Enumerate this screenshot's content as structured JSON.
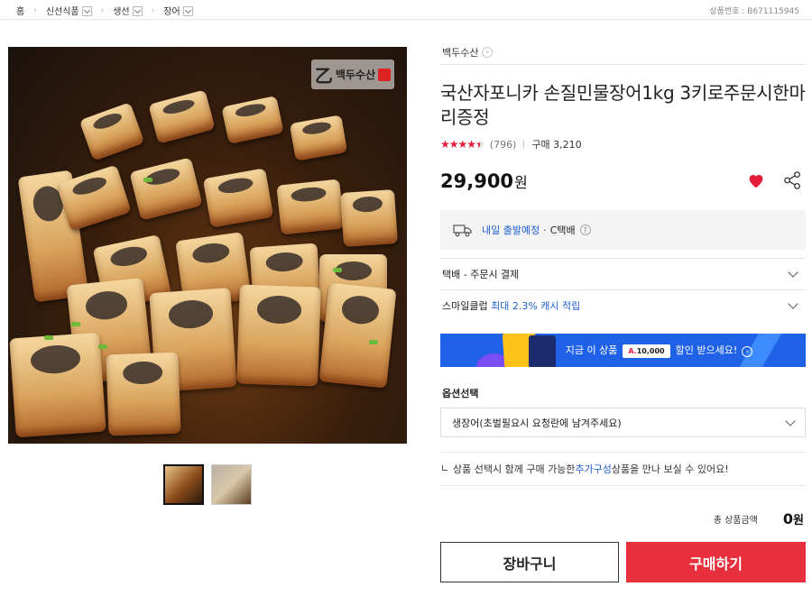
{
  "breadcrumb": {
    "items": [
      "홈",
      "신선식품",
      "생선",
      "장어"
    ]
  },
  "product_no_label": "상품번호 : B671115945",
  "image_logo_text": "백두수산",
  "thumbnails": [
    "thumbnail-1",
    "thumbnail-2"
  ],
  "store": {
    "name": "백두수산"
  },
  "product": {
    "title": "국산자포니카 손질민물장어1kg 3키로주문시한마리증정",
    "rating_value": 0.9,
    "review_count": "(796)",
    "purchase_count": "구매 3,210",
    "price": "29,900",
    "currency": "원"
  },
  "shipping": {
    "date_text": "내일 출발예정",
    "separator": "·",
    "carrier": "C택배",
    "help": "?"
  },
  "rows": {
    "delivery": "택배 - 주문시 결제",
    "smile_prefix": "스마일클럽 ",
    "smile_benefit": "최대 2.3% 캐시 적립"
  },
  "banner": {
    "prefix": "지금 이 상품",
    "coupon_prefix": "A.",
    "coupon_amount": "10,000",
    "suffix": "할인 받으세요!",
    "arrow": "›"
  },
  "options": {
    "label": "옵션선택",
    "selected": "생장어(초벌필요시 요청란에 남겨주세요)"
  },
  "hint": {
    "before": "상품 선택시 함께 구매 가능한 ",
    "link": "추가구성",
    "after": " 상품을 만나 보실 수 있어요!"
  },
  "total": {
    "label": "총 상품금액",
    "value": "0",
    "unit": "원"
  },
  "actions": {
    "cart": "장바구니",
    "buy": "구매하기"
  },
  "colors": {
    "accent_red": "#e8303c",
    "link_blue": "#1f5fcf",
    "banner_blue": "#1f62e8"
  },
  "icons": [
    "chevron-right-icon",
    "dropdown-icon",
    "heart-icon",
    "share-icon",
    "truck-icon",
    "help-icon",
    "chevron-down-icon"
  ]
}
